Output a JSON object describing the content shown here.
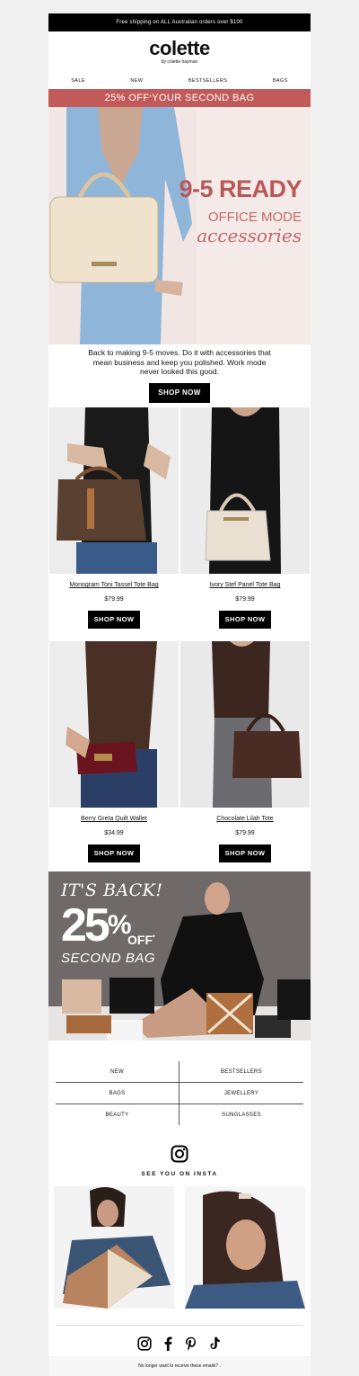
{
  "topbar": {
    "text": "Free shipping on ALL Australian orders over $100"
  },
  "logo": {
    "brand": "colette",
    "sub": "by colette hayman"
  },
  "nav": [
    "SALE",
    "NEW",
    "BESTSELLERS",
    "BAGS"
  ],
  "promo": {
    "pre": "25% OFF",
    "mark": "*",
    "post": " YOUR SECOND BAG"
  },
  "hero": {
    "line1": "9-5 READY",
    "line2": "OFFICE MODE",
    "line3": "accessories"
  },
  "intro": {
    "text": "Back to making 9-5 moves. Do it with accessories that mean business and keep you polished. Work mode never looked this good.",
    "button": "SHOP NOW"
  },
  "products": [
    {
      "name": "Monogram Toni Tassel Tote Bag",
      "price": "$79.99",
      "button": "SHOP NOW"
    },
    {
      "name": "Ivory Stef Panel Tote Bag",
      "price": "$79.99",
      "button": "SHOP NOW"
    },
    {
      "name": "Berry Greta Quilt Wallet",
      "price": "$34.99",
      "button": "SHOP NOW"
    },
    {
      "name": "Chocolate Lilah Tote",
      "price": "$79.99",
      "button": "SHOP NOW"
    }
  ],
  "back_banner": {
    "line1": "IT'S BACK!",
    "number": "25",
    "percent": "%",
    "off": "OFF",
    "mark": "*",
    "line3": "SECOND BAG"
  },
  "links": [
    "NEW",
    "BESTSELLERS",
    "BAGS",
    "JEWELLERY",
    "BEAUTY",
    "SUNGLASSES"
  ],
  "insta": {
    "label": "SEE YOU ON INSTA",
    "icon": "instagram-icon"
  },
  "social_icons": [
    "instagram-icon",
    "facebook-icon",
    "pinterest-icon",
    "tiktok-icon"
  ],
  "footer": {
    "text": "No longer want to receive these emails? ."
  },
  "colors": {
    "promo": "#c35a5a",
    "hero_text": "#b85858",
    "hero_bg": "#f4ebe9",
    "banner_bg": "#6f6a69"
  }
}
